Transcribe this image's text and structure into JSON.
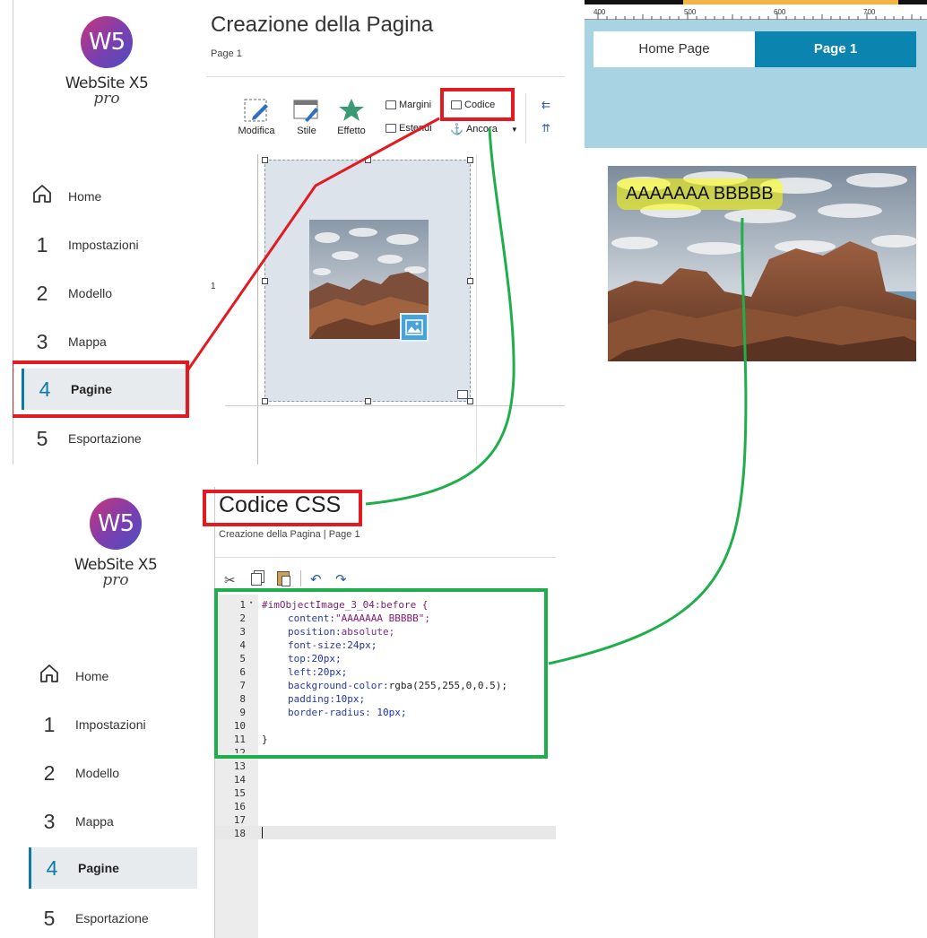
{
  "brand": {
    "logo_mark": "W5",
    "name": "WebSite X5",
    "edition": "pro"
  },
  "sidebar": {
    "items": [
      {
        "num": "",
        "label": "Home",
        "icon": "home-icon"
      },
      {
        "num": "1",
        "label": "Impostazioni"
      },
      {
        "num": "2",
        "label": "Modello"
      },
      {
        "num": "3",
        "label": "Mappa"
      },
      {
        "num": "4",
        "label": "Pagine",
        "active": true
      },
      {
        "num": "5",
        "label": "Esportazione"
      }
    ]
  },
  "editor": {
    "title": "Creazione della Pagina",
    "subtitle": "Page 1",
    "row_number": "1",
    "toolbar": {
      "modifica": "Modifica",
      "stile": "Stile",
      "effetto": "Effetto",
      "margini": "Margini",
      "codice": "Codice",
      "estendi": "Estendi",
      "ancora": "Ancora"
    }
  },
  "preview": {
    "ruler": [
      "400",
      "500",
      "600",
      "700"
    ],
    "nav": {
      "home": "Home Page",
      "page1": "Page 1"
    },
    "caption": "AAAAAAA BBBBB"
  },
  "css_editor": {
    "title": "Codice CSS",
    "breadcrumb": "Creazione della Pagina | Page 1",
    "line_numbers": [
      "1",
      "2",
      "3",
      "4",
      "5",
      "6",
      "7",
      "8",
      "9",
      "10",
      "11",
      "12",
      "13",
      "14",
      "15",
      "16",
      "17",
      "18"
    ],
    "code": {
      "selector": "#imObjectImage_3_04:before {",
      "l2_prop": "content:",
      "l2_val": "\"AAAAAAA BBBBB\";",
      "l3_prop": "position:",
      "l3_val": "absolute;",
      "l4_prop": "font-size:",
      "l4_val": "24px;",
      "l5_prop": "top:",
      "l5_val": "20px;",
      "l6_prop": "left:",
      "l6_val": "20px;",
      "l7_prop": "background-color:",
      "l7_val": "rgba(255,255,0,0.5);",
      "l8_prop": "padding:",
      "l8_val": "10px;",
      "l9_prop": "border-radius:",
      "l9_val": " 10px;",
      "close": "}"
    }
  },
  "colors": {
    "accent": "#0b7aa6",
    "highlight_red": "#e21b23",
    "highlight_green": "#1fae4b",
    "preview_band": "#a8d3e2",
    "nav_active": "#0b84b0"
  }
}
